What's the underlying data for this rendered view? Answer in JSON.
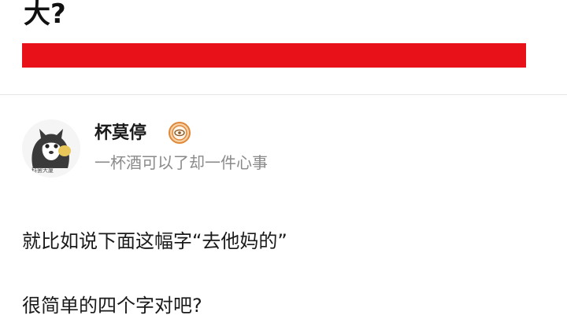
{
  "question": {
    "title_fragment": "大?"
  },
  "author": {
    "name": "杯莫停",
    "bio": "一杯酒可以了却一件心事",
    "avatar_caption": "科罢大厦",
    "badge_icon": "eye-badge-icon"
  },
  "answer": {
    "paragraphs": [
      "就比如说下面这幅字“去他妈的”",
      "很简单的四个字对吧?"
    ]
  },
  "colors": {
    "highlight_bar": "#e8111a",
    "badge_ring": "#e0883a",
    "muted_text": "#8a8a8a"
  }
}
